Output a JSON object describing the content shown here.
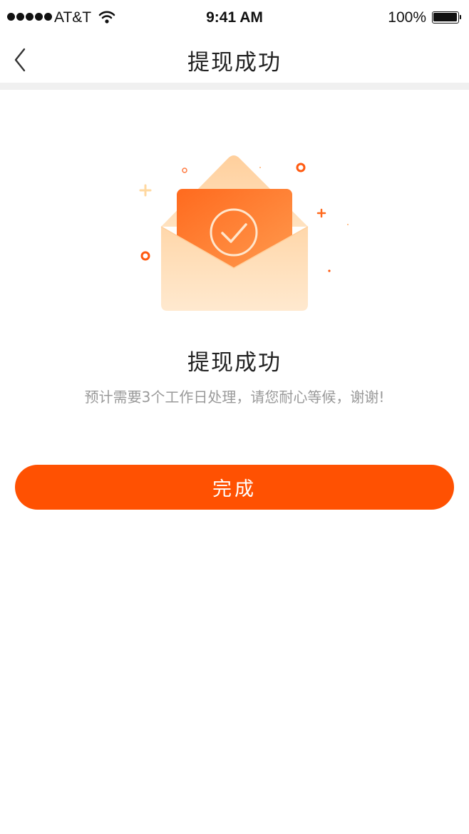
{
  "status_bar": {
    "carrier": "AT&T",
    "time": "9:41 AM",
    "battery": "100%"
  },
  "nav": {
    "title": "提现成功",
    "back_icon": "chevron-left-icon"
  },
  "result": {
    "illustration_icon": "envelope-check-icon",
    "title": "提现成功",
    "description": "预计需要3个工作日处理，请您耐心等候，谢谢!"
  },
  "actions": {
    "done_label": "完成"
  },
  "colors": {
    "accent": "#ff5102",
    "envelope_light": "#ffd8ad",
    "card_orange": "#ff7a30"
  }
}
